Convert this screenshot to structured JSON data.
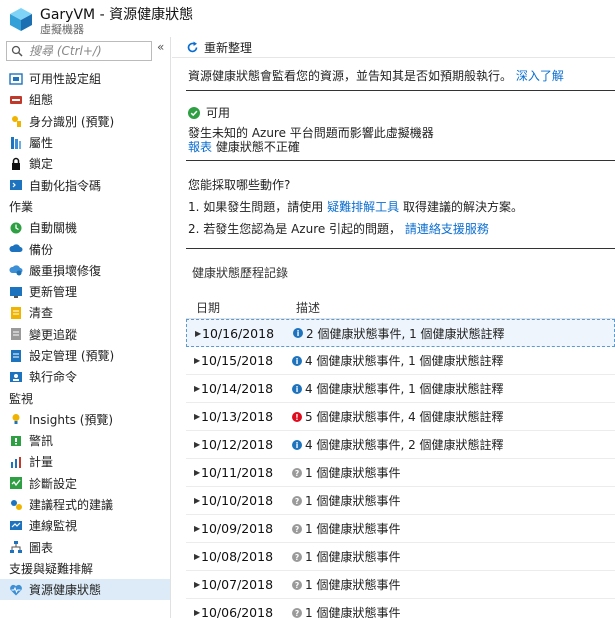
{
  "header": {
    "title": "GaryVM - 資源健康狀態",
    "subtitle": "虛擬機器"
  },
  "sidebar": {
    "search_placeholder": "搜尋 (Ctrl+/)",
    "collapse_label": "«",
    "items": [
      {
        "type": "item",
        "label": "可用性設定組",
        "icon": "availability-set-icon"
      },
      {
        "type": "item",
        "label": "組態",
        "icon": "configuration-icon"
      },
      {
        "type": "item",
        "label": "身分識別 (預覽)",
        "icon": "identity-icon"
      },
      {
        "type": "item",
        "label": "屬性",
        "icon": "properties-icon"
      },
      {
        "type": "item",
        "label": "鎖定",
        "icon": "lock-icon"
      },
      {
        "type": "item",
        "label": "自動化指令碼",
        "icon": "automation-script-icon"
      },
      {
        "type": "section",
        "label": "作業"
      },
      {
        "type": "item",
        "label": "自動關機",
        "icon": "auto-shutdown-icon"
      },
      {
        "type": "item",
        "label": "備份",
        "icon": "backup-icon"
      },
      {
        "type": "item",
        "label": "嚴重損壞修復",
        "icon": "disaster-recovery-icon"
      },
      {
        "type": "item",
        "label": "更新管理",
        "icon": "update-management-icon"
      },
      {
        "type": "item",
        "label": "清查",
        "icon": "inventory-icon"
      },
      {
        "type": "item",
        "label": "變更追蹤",
        "icon": "change-tracking-icon"
      },
      {
        "type": "item",
        "label": "設定管理 (預覽)",
        "icon": "config-management-icon"
      },
      {
        "type": "item",
        "label": "執行命令",
        "icon": "run-command-icon"
      },
      {
        "type": "section",
        "label": "監視"
      },
      {
        "type": "item",
        "label": "Insights (預覽)",
        "icon": "insights-icon"
      },
      {
        "type": "item",
        "label": "警訊",
        "icon": "alerts-icon"
      },
      {
        "type": "item",
        "label": "計量",
        "icon": "metrics-icon"
      },
      {
        "type": "item",
        "label": "診斷設定",
        "icon": "diagnostics-icon"
      },
      {
        "type": "item",
        "label": "建議程式的建議",
        "icon": "advisor-icon"
      },
      {
        "type": "item",
        "label": "連線監視",
        "icon": "connection-monitor-icon"
      },
      {
        "type": "item",
        "label": "圖表",
        "icon": "diagram-icon"
      },
      {
        "type": "section",
        "label": "支援與疑難排解"
      },
      {
        "type": "item",
        "label": "資源健康狀態",
        "icon": "resource-health-icon",
        "active": true
      }
    ]
  },
  "main": {
    "refresh_label": "重新整理",
    "intro_text": "資源健康狀態會監看您的資源，並告知其是否如預期般執行。",
    "intro_link": "深入了解",
    "status_label": "可用",
    "status_desc": "發生未知的 Azure 平台問題而影響此虛擬機器",
    "report_link": "報表",
    "report_text": "健康狀態不正確",
    "question": "您能採取哪些動作?",
    "step1_prefix": "1. 如果發生問題，請使用",
    "step1_link": "疑難排解工具",
    "step1_suffix": "取得建議的解決方案。",
    "step2_prefix": "2. 若發生您認為是 Azure 引起的問題，",
    "step2_link": "請連絡支援服務",
    "history_title": "健康狀態歷程記錄",
    "col_date": "日期",
    "col_desc": "描述",
    "rows": [
      {
        "date": "10/16/2018",
        "icon": "info",
        "desc": "2 個健康狀態事件, 1 個健康狀態註釋",
        "selected": true
      },
      {
        "date": "10/15/2018",
        "icon": "info",
        "desc": "4 個健康狀態事件, 1 個健康狀態註釋"
      },
      {
        "date": "10/14/2018",
        "icon": "info",
        "desc": "4 個健康狀態事件, 1 個健康狀態註釋"
      },
      {
        "date": "10/13/2018",
        "icon": "error",
        "desc": "5 個健康狀態事件, 4 個健康狀態註釋"
      },
      {
        "date": "10/12/2018",
        "icon": "info",
        "desc": "4 個健康狀態事件, 2 個健康狀態註釋"
      },
      {
        "date": "10/11/2018",
        "icon": "unknown",
        "desc": "1 個健康狀態事件"
      },
      {
        "date": "10/10/2018",
        "icon": "unknown",
        "desc": "1 個健康狀態事件"
      },
      {
        "date": "10/09/2018",
        "icon": "unknown",
        "desc": "1 個健康狀態事件"
      },
      {
        "date": "10/08/2018",
        "icon": "unknown",
        "desc": "1 個健康狀態事件"
      },
      {
        "date": "10/07/2018",
        "icon": "unknown",
        "desc": "1 個健康狀態事件"
      },
      {
        "date": "10/06/2018",
        "icon": "unknown",
        "desc": "1 個健康狀態事件"
      }
    ]
  },
  "colors": {
    "link": "#0a6ed1",
    "ok": "#2ea043",
    "info": "#1e73be",
    "error": "#e00b1c",
    "unknown": "#9a9a9a",
    "active_bg": "#dcebf7"
  }
}
